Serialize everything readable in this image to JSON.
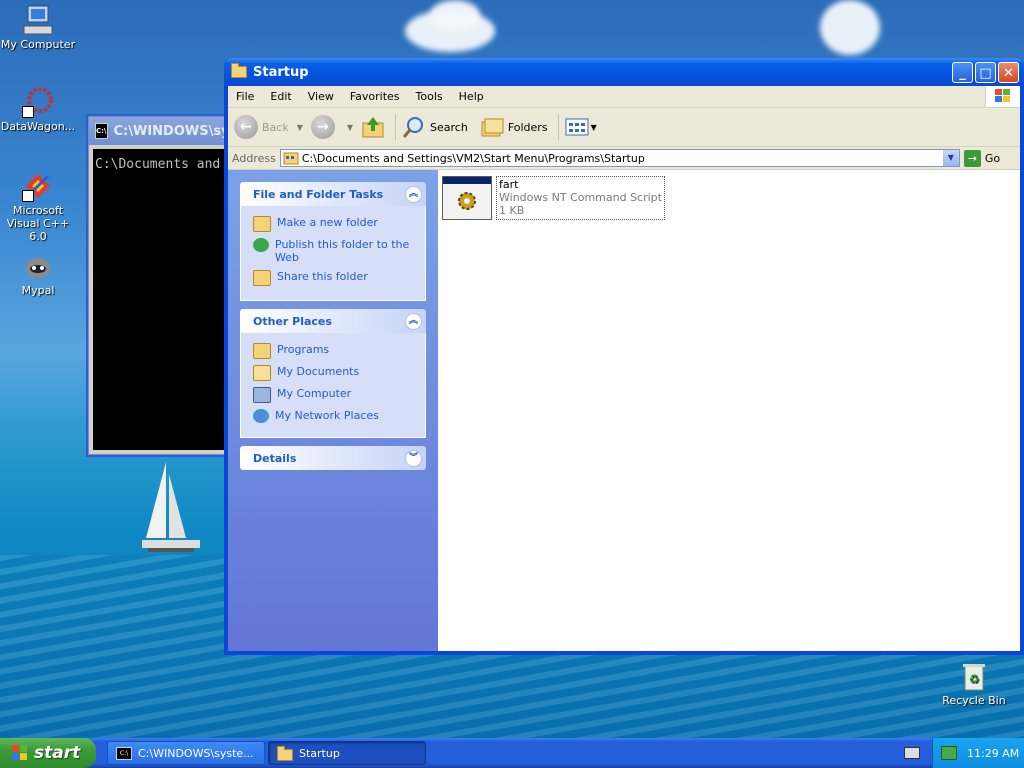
{
  "desktop": {
    "icons": [
      {
        "label": "My Computer",
        "icon": "my-computer-icon"
      },
      {
        "label": "DataWagon...",
        "icon": "datawagon-shortcut-icon"
      },
      {
        "label": "Microsoft Visual C++ 6.0",
        "icon": "visual-cpp-shortcut-icon"
      },
      {
        "label": "Mypal",
        "icon": "mypal-icon"
      },
      {
        "label": "Recycle Bin",
        "icon": "recycle-bin-icon"
      }
    ]
  },
  "console": {
    "title": "C:\\WINDOWS\\syst",
    "icon_label": "C:\\",
    "text": "C:\\Documents and"
  },
  "explorer": {
    "title": "Startup",
    "caption": {
      "minimize": "_",
      "maximize": "□",
      "close": "✕"
    },
    "menu": [
      "File",
      "Edit",
      "View",
      "Favorites",
      "Tools",
      "Help"
    ],
    "toolbar": {
      "back": "Back",
      "search": "Search",
      "folders": "Folders"
    },
    "address": {
      "label": "Address",
      "value": "C:\\Documents and Settings\\VM2\\Start Menu\\Programs\\Startup",
      "go": "Go"
    },
    "panels": {
      "file_tasks": {
        "title": "File and Folder Tasks",
        "items": [
          "Make a new folder",
          "Publish this folder to the Web",
          "Share this folder"
        ]
      },
      "other_places": {
        "title": "Other Places",
        "items": [
          "Programs",
          "My Documents",
          "My Computer",
          "My Network Places"
        ]
      },
      "details": {
        "title": "Details"
      }
    },
    "file": {
      "name": "fart",
      "type": "Windows NT Command Script",
      "size": "1 KB"
    }
  },
  "taskbar": {
    "start": "start",
    "buttons": [
      {
        "label": "C:\\WINDOWS\\syste...",
        "active": false
      },
      {
        "label": "Startup",
        "active": true
      }
    ],
    "time": "11:29 AM"
  },
  "colors": {
    "xp_blue": "#0a46d8",
    "link_blue": "#215dc6",
    "start_green": "#3c9b38"
  }
}
